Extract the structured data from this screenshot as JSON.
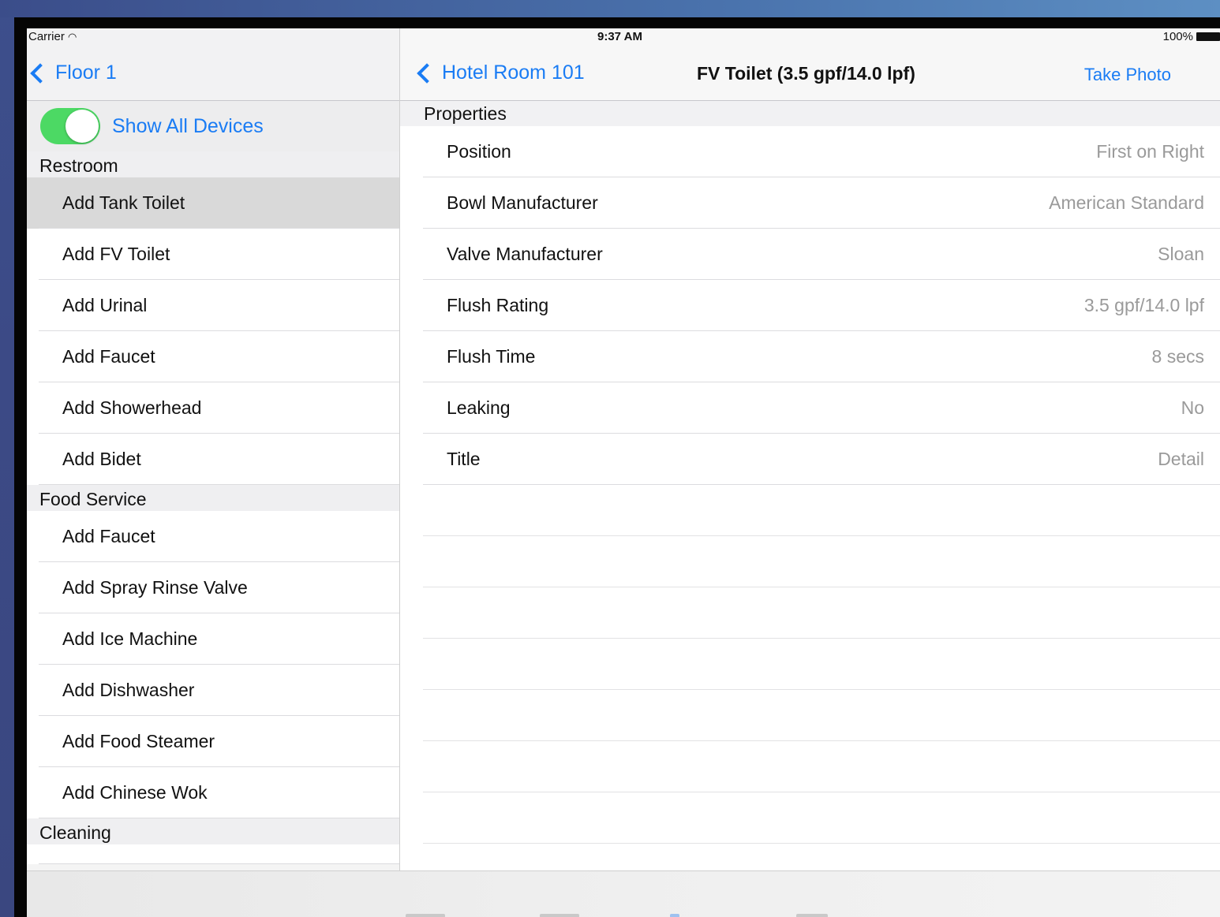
{
  "status_bar": {
    "carrier": "Carrier",
    "time": "9:37 AM",
    "battery": "100%"
  },
  "master": {
    "back_label": "Floor 1",
    "toggle_label": "Show All Devices",
    "toggle_on": true,
    "sections": [
      {
        "title": "Restroom",
        "items": [
          "Add Tank Toilet",
          "Add FV Toilet",
          "Add Urinal",
          "Add Faucet",
          "Add Showerhead",
          "Add Bidet"
        ]
      },
      {
        "title": "Food Service",
        "items": [
          "Add Faucet",
          "Add Spray Rinse Valve",
          "Add Ice Machine",
          "Add Dishwasher",
          "Add Food Steamer",
          "Add Chinese Wok"
        ]
      },
      {
        "title": "Cleaning",
        "items": []
      }
    ]
  },
  "detail": {
    "back_label": "Hotel Room 101",
    "title": "FV Toilet (3.5 gpf/14.0 lpf)",
    "take_photo_label": "Take Photo",
    "section_title": "Properties",
    "properties": [
      {
        "label": "Position",
        "value": "First on Right"
      },
      {
        "label": "Bowl Manufacturer",
        "value": "American Standard"
      },
      {
        "label": "Valve Manufacturer",
        "value": "Sloan"
      },
      {
        "label": "Flush Rating",
        "value": "3.5 gpf/14.0 lpf"
      },
      {
        "label": "Flush Time",
        "value": "8 secs"
      },
      {
        "label": "Leaking",
        "value": "No"
      },
      {
        "label": "Title",
        "value": "Detail"
      }
    ]
  },
  "colors": {
    "accent": "#1a7cf4",
    "toggle_on": "#4cd964",
    "value_gray": "#9a9a9a"
  }
}
